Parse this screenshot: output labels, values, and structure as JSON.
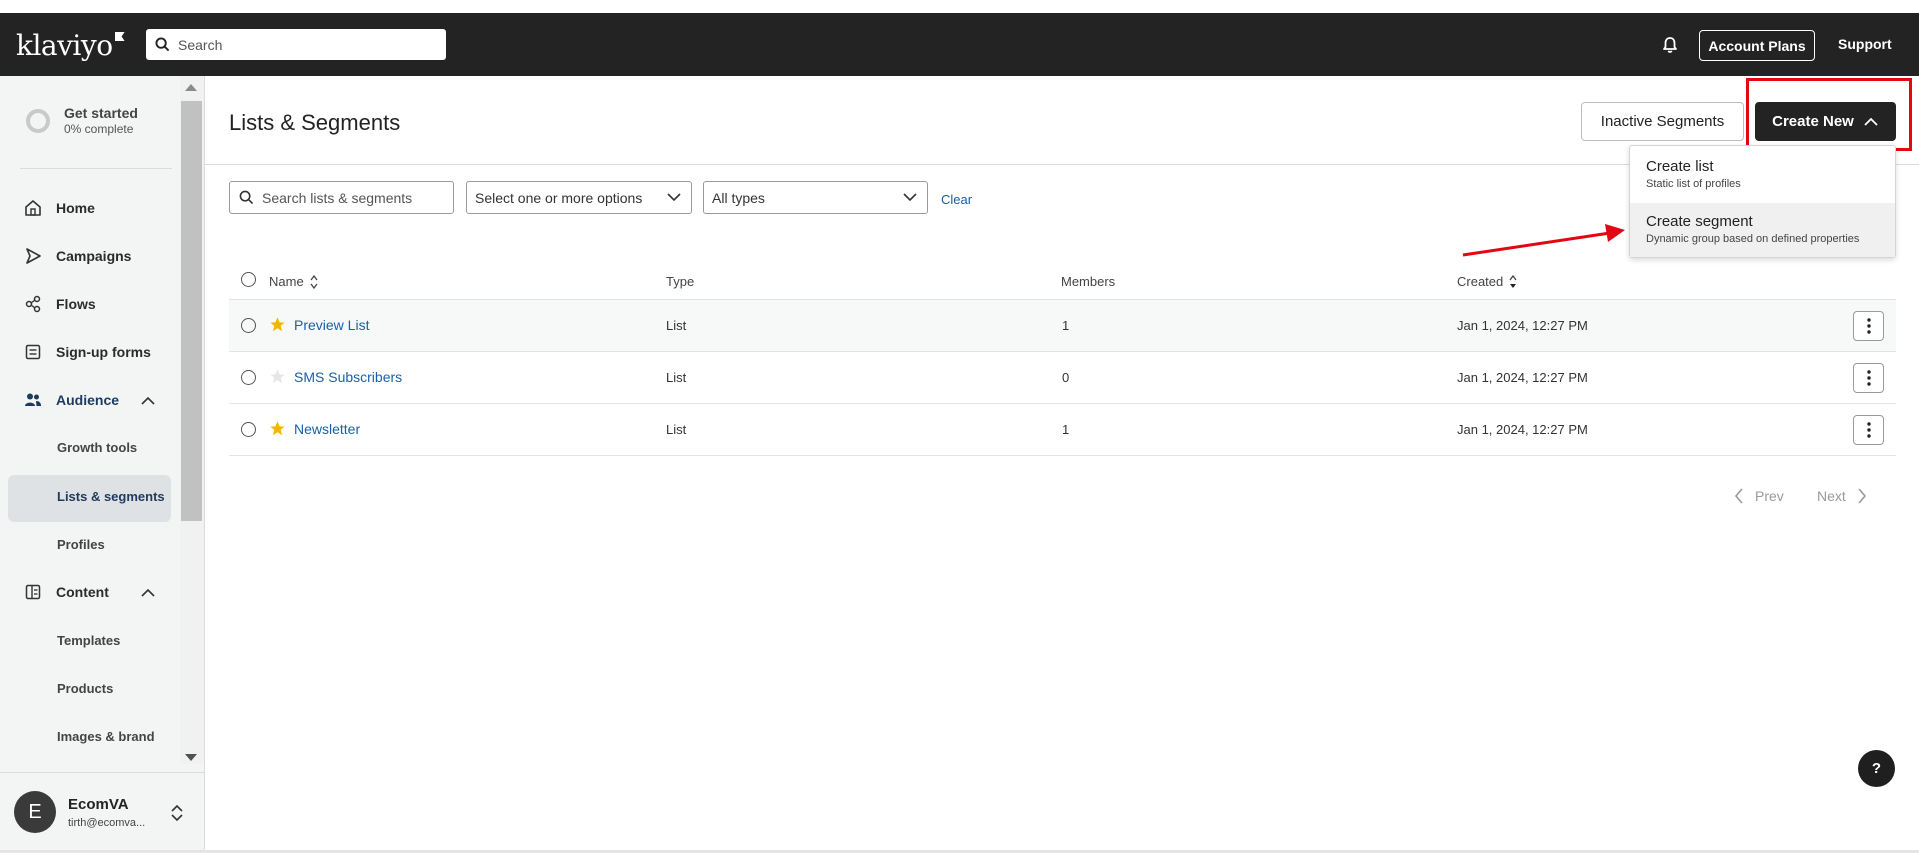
{
  "header": {
    "logo": "klaviyo",
    "search_placeholder": "Search",
    "account_plans": "Account Plans",
    "support": "Support"
  },
  "sidebar": {
    "get_started_title": "Get started",
    "get_started_progress": "0% complete",
    "nav": [
      {
        "label": "Home",
        "icon": "home-icon"
      },
      {
        "label": "Campaigns",
        "icon": "campaigns-icon"
      },
      {
        "label": "Flows",
        "icon": "flows-icon"
      },
      {
        "label": "Sign-up forms",
        "icon": "forms-icon"
      },
      {
        "label": "Audience",
        "icon": "audience-icon"
      },
      {
        "label": "Content",
        "icon": "content-icon"
      }
    ],
    "audience_sub": [
      "Growth tools",
      "Lists & segments",
      "Profiles"
    ],
    "content_sub": [
      "Templates",
      "Products",
      "Images & brand"
    ],
    "user": {
      "initial": "E",
      "name": "EcomVA",
      "email": "tirth@ecomva..."
    }
  },
  "main": {
    "title": "Lists & Segments",
    "inactive_button": "Inactive Segments",
    "create_button": "Create New",
    "filters": {
      "search_placeholder": "Search lists & segments",
      "options_placeholder": "Select one or more options",
      "types_value": "All types",
      "clear": "Clear"
    },
    "dropdown": [
      {
        "title": "Create list",
        "sub": "Static list of profiles"
      },
      {
        "title": "Create segment",
        "sub": "Dynamic group based on defined properties"
      }
    ],
    "table": {
      "columns": [
        "Name",
        "Type",
        "Members",
        "Created"
      ],
      "rows": [
        {
          "name": "Preview List",
          "starred": true,
          "type": "List",
          "members": "1",
          "created": "Jan 1, 2024, 12:27 PM"
        },
        {
          "name": "SMS Subscribers",
          "starred": false,
          "type": "List",
          "members": "0",
          "created": "Jan 1, 2024, 12:27 PM"
        },
        {
          "name": "Newsletter",
          "starred": true,
          "type": "List",
          "members": "1",
          "created": "Jan 1, 2024, 12:27 PM"
        }
      ]
    },
    "pagination": {
      "prev": "Prev",
      "next": "Next"
    },
    "help": "?"
  },
  "colors": {
    "accent": "#1b5fa6",
    "star": "#f2b600",
    "highlight": "#e30613",
    "header_bg": "#232323"
  }
}
